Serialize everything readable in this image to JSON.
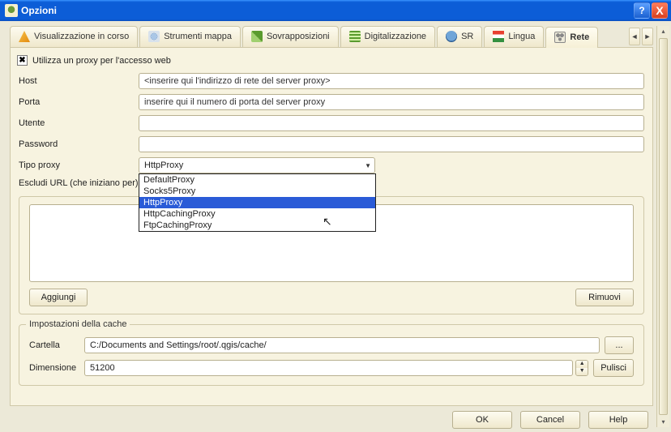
{
  "window": {
    "title": "Opzioni",
    "help": "?",
    "close": "X"
  },
  "tabs": {
    "vis": "Visualizzazione in corso",
    "tools": "Strumenti mappa",
    "overlay": "Sovrapposizioni",
    "digit": "Digitalizzazione",
    "sr": "SR",
    "lang": "Lingua",
    "net": "Rete"
  },
  "proxy": {
    "checkbox_label": "Utilizza un proxy per l'accesso web",
    "checked": "✖",
    "host_label": "Host",
    "host_value": "<inserire qui l'indirizzo di rete del server proxy>",
    "port_label": "Porta",
    "port_value": "inserire qui il numero di porta del server proxy",
    "user_label": "Utente",
    "user_value": "",
    "pass_label": "Password",
    "pass_value": "",
    "type_label": "Tipo proxy",
    "type_selected": "HttpProxy",
    "exclude_label": "Escludi URL (che iniziano per)",
    "options": [
      "DefaultProxy",
      "Socks5Proxy",
      "HttpProxy",
      "HttpCachingProxy",
      "FtpCachingProxy"
    ],
    "add_btn": "Aggiungi",
    "remove_btn": "Rimuovi"
  },
  "cache": {
    "group_label": "Impostazioni della cache",
    "dir_label": "Cartella",
    "dir_value": "C:/Documents and Settings/root/.qgis/cache/",
    "browse": "...",
    "size_label": "Dimensione",
    "size_value": "51200",
    "clear_btn": "Pulisci"
  },
  "dialog": {
    "ok": "OK",
    "cancel": "Cancel",
    "help": "Help"
  }
}
